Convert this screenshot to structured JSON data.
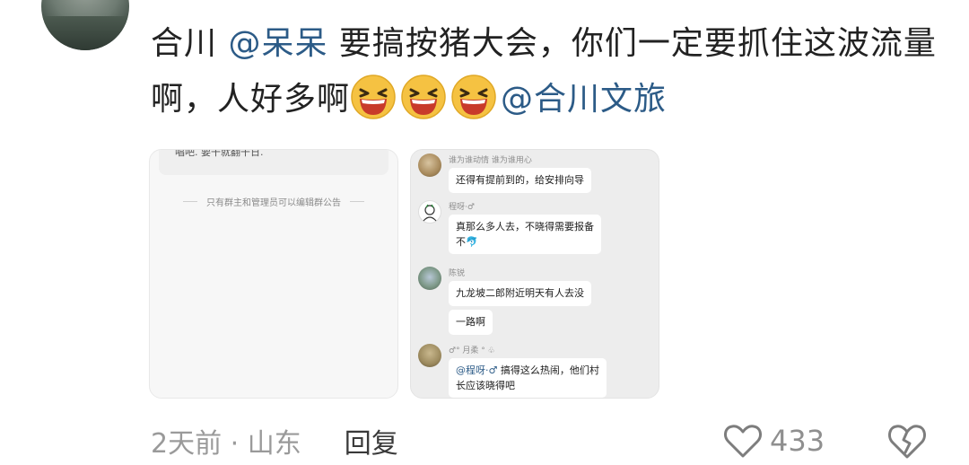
{
  "comment": {
    "author": "合川",
    "mention_1": "@呆呆",
    "text_1": " 要搞按猪大会，你们一定要抓住这波流量啊，人好多啊",
    "emoji": "laughing-face-emoji",
    "emoji_count": 3,
    "mention_2": "@合川文旅"
  },
  "left_screenshot": {
    "cut_text": "唱吧.  要干就翻干日.",
    "notice": "只有群主和管理员可以编辑群公告"
  },
  "right_screenshot": {
    "messages": [
      {
        "name": "谁为谁动情  谁为谁用心",
        "text": "还得有提前到的，给安排向导"
      },
      {
        "name": "程呀·♂",
        "text": "真那么多人去，不晓得需要报备",
        "text_2": "不"
      },
      {
        "name": "陈锐",
        "text": "九龙坡二郎附近明天有人去没",
        "text_2": "一路啊"
      },
      {
        "name": "♂° 月柔 ° ♧",
        "mention": "@程呀·♂",
        "text": " 搞得这么热闹，他们村",
        "text_2": "长应该晓得吧"
      }
    ]
  },
  "footer": {
    "time_location": "2天前 · 山东",
    "reply_label": "回复",
    "like_count": "433"
  },
  "colors": {
    "mention": "#2c5b87",
    "meta": "#9a9a9a"
  }
}
